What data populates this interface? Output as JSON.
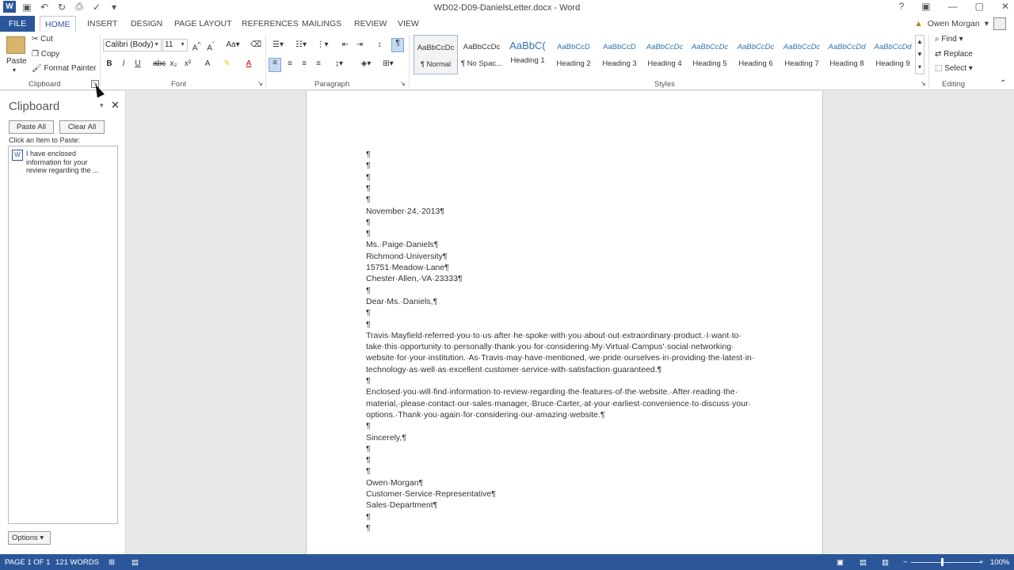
{
  "window": {
    "title": "WD02-D09-DanielsLetter.docx - Word",
    "controls": [
      "?",
      "▣",
      "—",
      "▢",
      "✕"
    ]
  },
  "qat": {
    "app_icon": "W"
  },
  "tabs": [
    "FILE",
    "HOME",
    "INSERT",
    "DESIGN",
    "PAGE LAYOUT",
    "REFERENCES",
    "MAILINGS",
    "REVIEW",
    "VIEW"
  ],
  "user": {
    "name": "Owen Morgan"
  },
  "ribbon": {
    "clipboard": {
      "paste": "Paste",
      "cut": "Cut",
      "copy": "Copy",
      "format_painter": "Format Painter",
      "label": "Clipboard"
    },
    "font": {
      "name": "Calibri (Body)",
      "size": "11",
      "label": "Font"
    },
    "paragraph": {
      "label": "Paragraph"
    },
    "styles": {
      "label": "Styles",
      "items": [
        {
          "sample": "AaBbCcDc",
          "name": "¶ Normal"
        },
        {
          "sample": "AaBbCcDc",
          "name": "¶ No Spac..."
        },
        {
          "sample": "AaBbC(",
          "name": "Heading 1"
        },
        {
          "sample": "AaBbCcD",
          "name": "Heading 2"
        },
        {
          "sample": "AaBbCcD",
          "name": "Heading 3"
        },
        {
          "sample": "AaBbCcDc",
          "name": "Heading 4"
        },
        {
          "sample": "AaBbCcDc",
          "name": "Heading 5"
        },
        {
          "sample": "AaBbCcDc",
          "name": "Heading 6"
        },
        {
          "sample": "AaBbCcDc",
          "name": "Heading 7"
        },
        {
          "sample": "AaBbCcDd",
          "name": "Heading 8"
        },
        {
          "sample": "AaBbCcDd",
          "name": "Heading 9"
        }
      ]
    },
    "editing": {
      "find": "Find",
      "replace": "Replace",
      "select": "Select",
      "label": "Editing"
    }
  },
  "clipboard_pane": {
    "title": "Clipboard",
    "paste_all": "Paste All",
    "clear_all": "Clear All",
    "hint": "Click an Item to Paste:",
    "item_text": "I have enclosed information for your review regarding the ...",
    "options": "Options"
  },
  "document": {
    "lines": [
      "¶",
      "¶",
      "¶",
      "¶",
      "¶",
      "November·24,·2013¶",
      "¶",
      "¶",
      "Ms.·Paige·Daniels¶",
      "Richmond·University¶",
      "15751·Meadow·Lane¶",
      "Chester·Allen,·VA·23333¶",
      "¶",
      "Dear·Ms.·Daniels,¶",
      "¶",
      "¶",
      "Travis·Mayfield·referred·you·to·us·after·he·spoke·with·you·about·out·extraordinary·product.·I·want·to·",
      "take·this·opportunity·to·personally·thank·you·for·considering·My·Virtual·Campus'·social·networking·",
      "website·for·your·institution.·As·Travis·may·have·mentioned,·we·pride·ourselves·in·providing·the·latest·in·",
      "technology·as·well·as·excellent·customer·service·with·satisfaction·guaranteed.¶",
      "¶",
      "Enclosed·you·will·find·information·to·review·regarding·the·features·of·the·website.·After·reading·the·",
      "material,·please·contact·our·sales·manager,·Bruce·Carter,·at·your·earliest·convenience·to·discuss·your·",
      "options.·Thank·you·again·for·considering·our·amazing·website.¶",
      "¶",
      "Sincerely,¶",
      "¶",
      "¶",
      "¶",
      "Owen·Morgan¶",
      "Customer·Service·Representative¶",
      "Sales·Department¶",
      "¶",
      "¶"
    ]
  },
  "status": {
    "page": "PAGE 1 OF 1",
    "words": "121 WORDS",
    "zoom": "100%"
  }
}
